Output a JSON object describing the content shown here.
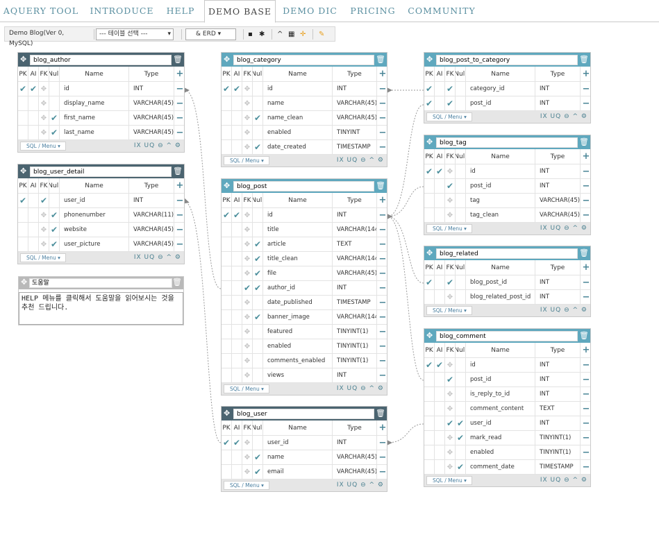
{
  "tabs": [
    {
      "label": "AQUERY TOOL",
      "active": false
    },
    {
      "label": "INTRODUCE",
      "active": false
    },
    {
      "label": "HELP",
      "active": false
    },
    {
      "label": "DEMO BASE",
      "active": true
    },
    {
      "label": "DEMO DIC",
      "active": false
    },
    {
      "label": "PRICING",
      "active": false
    },
    {
      "label": "COMMUNITY",
      "active": false
    }
  ],
  "toolbar": {
    "project": "Demo Blog(Ver 0, MySQL)",
    "table_select": "--- 테이블 선택 ---",
    "erd_button": "ERD",
    "icons": [
      "save-icon",
      "settings-icon",
      "collapse-icon",
      "grid-icon",
      "move-icon",
      "pin-icon"
    ]
  },
  "columns_header": {
    "pk": "PK",
    "ai": "AI",
    "fk": "FK",
    "null": "Null",
    "name": "Name",
    "type": "Type"
  },
  "footer": {
    "sql_menu": "SQL / Menu",
    "ix": "IX",
    "uq": "UQ"
  },
  "colors": {
    "dark_header": "#4b6470",
    "light_header": "#5fa8be",
    "accent": "#4a8697",
    "tab_text": "#5a8fa0"
  },
  "help": {
    "title": "도움말",
    "text": "HELP 메뉴를 클릭해서 도움말을 읽어보시는 것을 추천 드립니다."
  },
  "tables": [
    {
      "key": "author",
      "name": "blog_author",
      "header": "dark",
      "rows": [
        {
          "pk": true,
          "ai": true,
          "fk": false,
          "null": false,
          "name": "id",
          "type": "INT"
        },
        {
          "pk": false,
          "ai": false,
          "fk": false,
          "null": false,
          "name": "display_name",
          "type": "VARCHAR(45)"
        },
        {
          "pk": false,
          "ai": false,
          "fk": false,
          "null": true,
          "name": "first_name",
          "type": "VARCHAR(45)"
        },
        {
          "pk": false,
          "ai": false,
          "fk": false,
          "null": true,
          "name": "last_name",
          "type": "VARCHAR(45)"
        }
      ]
    },
    {
      "key": "user_detail",
      "name": "blog_user_detail",
      "header": "dark",
      "rows": [
        {
          "pk": true,
          "ai": false,
          "fk": true,
          "null": false,
          "name": "user_id",
          "type": "INT"
        },
        {
          "pk": false,
          "ai": false,
          "fk": false,
          "null": true,
          "name": "phonenumber",
          "type": "VARCHAR(11)"
        },
        {
          "pk": false,
          "ai": false,
          "fk": false,
          "null": true,
          "name": "website",
          "type": "VARCHAR(45)"
        },
        {
          "pk": false,
          "ai": false,
          "fk": false,
          "null": true,
          "name": "user_picture",
          "type": "VARCHAR(45)"
        }
      ]
    },
    {
      "key": "category",
      "name": "blog_category",
      "header": "light",
      "rows": [
        {
          "pk": true,
          "ai": true,
          "fk": false,
          "null": false,
          "name": "id",
          "type": "INT"
        },
        {
          "pk": false,
          "ai": false,
          "fk": false,
          "null": false,
          "name": "name",
          "type": "VARCHAR(45)"
        },
        {
          "pk": false,
          "ai": false,
          "fk": false,
          "null": true,
          "name": "name_clean",
          "type": "VARCHAR(45)"
        },
        {
          "pk": false,
          "ai": false,
          "fk": false,
          "null": false,
          "name": "enabled",
          "type": "TINYINT"
        },
        {
          "pk": false,
          "ai": false,
          "fk": false,
          "null": true,
          "name": "date_created",
          "type": "TIMESTAMP"
        }
      ]
    },
    {
      "key": "post",
      "name": "blog_post",
      "header": "light",
      "rows": [
        {
          "pk": true,
          "ai": true,
          "fk": false,
          "null": false,
          "name": "id",
          "type": "INT"
        },
        {
          "pk": false,
          "ai": false,
          "fk": false,
          "null": false,
          "name": "title",
          "type": "VARCHAR(144)"
        },
        {
          "pk": false,
          "ai": false,
          "fk": false,
          "null": true,
          "name": "article",
          "type": "TEXT"
        },
        {
          "pk": false,
          "ai": false,
          "fk": false,
          "null": true,
          "name": "title_clean",
          "type": "VARCHAR(144)"
        },
        {
          "pk": false,
          "ai": false,
          "fk": false,
          "null": true,
          "name": "file",
          "type": "VARCHAR(45)"
        },
        {
          "pk": false,
          "ai": false,
          "fk": true,
          "null": true,
          "name": "author_id",
          "type": "INT"
        },
        {
          "pk": false,
          "ai": false,
          "fk": false,
          "null": false,
          "name": "date_published",
          "type": "TIMESTAMP"
        },
        {
          "pk": false,
          "ai": false,
          "fk": false,
          "null": true,
          "name": "banner_image",
          "type": "VARCHAR(144)"
        },
        {
          "pk": false,
          "ai": false,
          "fk": false,
          "null": false,
          "name": "featured",
          "type": "TINYINT(1)"
        },
        {
          "pk": false,
          "ai": false,
          "fk": false,
          "null": false,
          "name": "enabled",
          "type": "TINYINT(1)"
        },
        {
          "pk": false,
          "ai": false,
          "fk": false,
          "null": false,
          "name": "comments_enabled",
          "type": "TINYINT(1)"
        },
        {
          "pk": false,
          "ai": false,
          "fk": false,
          "null": false,
          "name": "views",
          "type": "INT"
        }
      ]
    },
    {
      "key": "user",
      "name": "blog_user",
      "header": "dark",
      "rows": [
        {
          "pk": true,
          "ai": true,
          "fk": false,
          "null": false,
          "name": "user_id",
          "type": "INT"
        },
        {
          "pk": false,
          "ai": false,
          "fk": false,
          "null": true,
          "name": "name",
          "type": "VARCHAR(45)"
        },
        {
          "pk": false,
          "ai": false,
          "fk": false,
          "null": true,
          "name": "email",
          "type": "VARCHAR(45)"
        }
      ]
    },
    {
      "key": "post_to_category",
      "name": "blog_post_to_category",
      "header": "light",
      "rows": [
        {
          "pk": true,
          "ai": false,
          "fk": true,
          "null": false,
          "name": "category_id",
          "type": "INT"
        },
        {
          "pk": true,
          "ai": false,
          "fk": true,
          "null": false,
          "name": "post_id",
          "type": "INT"
        }
      ]
    },
    {
      "key": "tag",
      "name": "blog_tag",
      "header": "light",
      "rows": [
        {
          "pk": true,
          "ai": true,
          "fk": false,
          "null": false,
          "name": "id",
          "type": "INT"
        },
        {
          "pk": false,
          "ai": false,
          "fk": true,
          "null": false,
          "name": "post_id",
          "type": "INT"
        },
        {
          "pk": false,
          "ai": false,
          "fk": false,
          "null": false,
          "name": "tag",
          "type": "VARCHAR(45)"
        },
        {
          "pk": false,
          "ai": false,
          "fk": false,
          "null": false,
          "name": "tag_clean",
          "type": "VARCHAR(45)"
        }
      ]
    },
    {
      "key": "related",
      "name": "blog_related",
      "header": "light",
      "rows": [
        {
          "pk": true,
          "ai": false,
          "fk": true,
          "null": false,
          "name": "blog_post_id",
          "type": "INT"
        },
        {
          "pk": false,
          "ai": false,
          "fk": false,
          "null": false,
          "name": "blog_related_post_id",
          "type": "INT"
        }
      ]
    },
    {
      "key": "comment",
      "name": "blog_comment",
      "header": "light",
      "rows": [
        {
          "pk": true,
          "ai": true,
          "fk": false,
          "null": false,
          "name": "id",
          "type": "INT"
        },
        {
          "pk": false,
          "ai": false,
          "fk": true,
          "null": false,
          "name": "post_id",
          "type": "INT"
        },
        {
          "pk": false,
          "ai": false,
          "fk": false,
          "null": false,
          "name": "is_reply_to_id",
          "type": "INT"
        },
        {
          "pk": false,
          "ai": false,
          "fk": false,
          "null": false,
          "name": "comment_content",
          "type": "TEXT"
        },
        {
          "pk": false,
          "ai": false,
          "fk": true,
          "null": true,
          "name": "user_id",
          "type": "INT"
        },
        {
          "pk": false,
          "ai": false,
          "fk": false,
          "null": true,
          "name": "mark_read",
          "type": "TINYINT(1)"
        },
        {
          "pk": false,
          "ai": false,
          "fk": false,
          "null": false,
          "name": "enabled",
          "type": "TINYINT(1)"
        },
        {
          "pk": false,
          "ai": false,
          "fk": false,
          "null": true,
          "name": "comment_date",
          "type": "TIMESTAMP"
        }
      ]
    }
  ]
}
